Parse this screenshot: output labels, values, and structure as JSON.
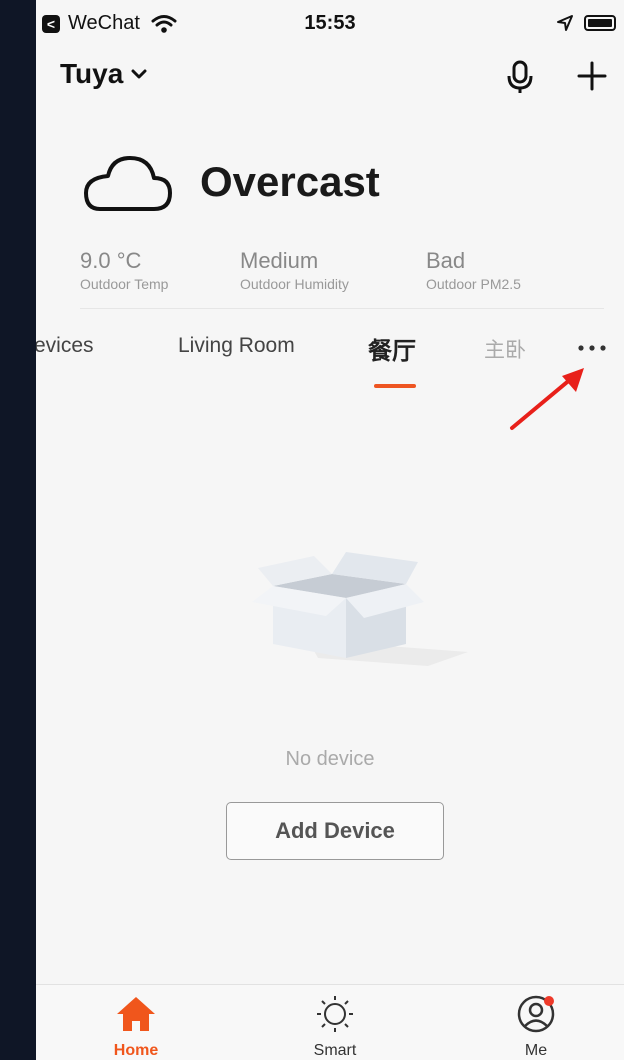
{
  "status_bar": {
    "back_glyph": "<",
    "app": "WeChat",
    "time": "15:53",
    "icons": [
      "wifi-icon",
      "location-arrow-icon",
      "battery-icon"
    ]
  },
  "header": {
    "home_name": "Tuya",
    "icons": [
      "chevron-down-icon",
      "microphone-icon",
      "plus-icon"
    ]
  },
  "weather": {
    "condition": "Overcast",
    "stats": [
      {
        "value": "9.0 °C",
        "label": "Outdoor Temp"
      },
      {
        "value": "Medium",
        "label": "Outdoor Humidity"
      },
      {
        "value": "Bad",
        "label": "Outdoor PM2.5"
      }
    ]
  },
  "tabs": [
    {
      "label": "evices"
    },
    {
      "label": "Living Room"
    },
    {
      "label": "餐厅"
    },
    {
      "label": "主卧"
    }
  ],
  "active_tab_index": 2,
  "empty_state": {
    "message": "No device",
    "button": "Add Device"
  },
  "bottom_nav": [
    {
      "label": "Home",
      "icon": "home-icon",
      "active": true
    },
    {
      "label": "Smart",
      "icon": "sun-icon",
      "active": false
    },
    {
      "label": "Me",
      "icon": "user-icon",
      "active": false,
      "badge": true
    }
  ],
  "colors": {
    "accent": "#f0561c",
    "tab_underline": "#ee5522",
    "annotation_arrow": "#e8201a",
    "outer_background": "#0f1626"
  }
}
